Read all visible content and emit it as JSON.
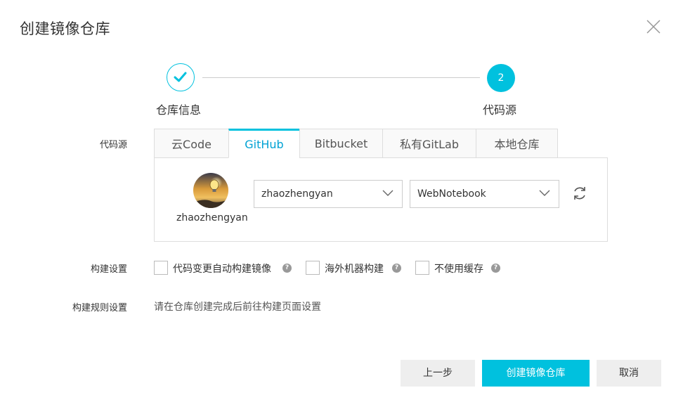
{
  "dialog": {
    "title": "创建镜像仓库"
  },
  "steps": [
    {
      "label": "仓库信息",
      "state": "done",
      "icon": "check-icon"
    },
    {
      "label": "代码源",
      "number": "2",
      "state": "active"
    }
  ],
  "form": {
    "source_label": "代码源",
    "tabs": [
      {
        "label": "云Code"
      },
      {
        "label": "GitHub",
        "active": true
      },
      {
        "label": "Bitbucket"
      },
      {
        "label": "私有GitLab"
      },
      {
        "label": "本地仓库"
      }
    ],
    "account": {
      "username": "zhaozhengyan",
      "selected_user": "zhaozhengyan",
      "selected_repo": "WebNotebook"
    },
    "build_settings_label": "构建设置",
    "build_options": [
      {
        "label": "代码变更自动构建镜像",
        "checked": false
      },
      {
        "label": "海外机器构建",
        "checked": false
      },
      {
        "label": "不使用缓存",
        "checked": false
      }
    ],
    "build_rules_label": "构建规则设置",
    "build_rules_text": "请在仓库创建完成后前往构建页面设置"
  },
  "footer": {
    "prev_label": "上一步",
    "create_label": "创建镜像仓库",
    "cancel_label": "取消"
  },
  "colors": {
    "accent": "#00c1de",
    "tab_active_text": "#00a2d4",
    "border": "#dddddd",
    "button_gray": "#eeeeee"
  }
}
